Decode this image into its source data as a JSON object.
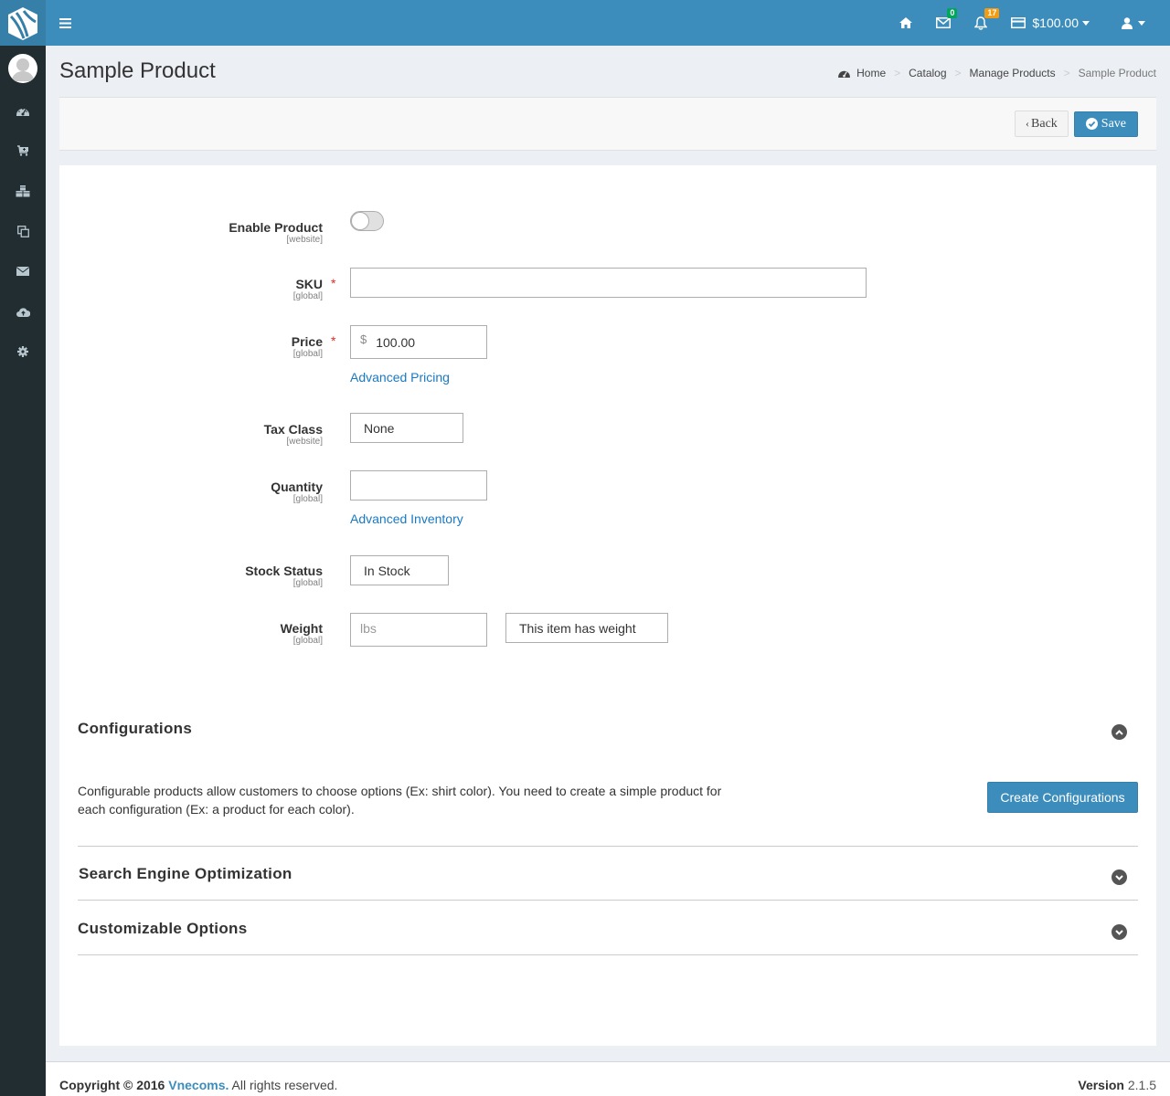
{
  "topbar": {
    "messages_count": "0",
    "notifications_count": "17",
    "balance": "$100.00",
    "colors": {
      "primary": "#3c8dbc",
      "logo_bg": "#367fa9",
      "sidebar_bg": "#222d32"
    }
  },
  "sidebar": {
    "items": [
      {
        "icon": "dashboard-icon"
      },
      {
        "icon": "cart-icon"
      },
      {
        "icon": "cubes-icon"
      },
      {
        "icon": "copy-icon"
      },
      {
        "icon": "envelope-icon"
      },
      {
        "icon": "cloud-upload-icon"
      },
      {
        "icon": "gear-icon"
      }
    ]
  },
  "header": {
    "title": "Sample Product",
    "breadcrumb": [
      "Home",
      "Catalog",
      "Manage Products",
      "Sample Product"
    ],
    "breadcrumb_sep": ">"
  },
  "actions": {
    "back_label": "Back",
    "save_label": "Save"
  },
  "form": {
    "enable_product": {
      "label": "Enable Product",
      "scope": "[website]",
      "enabled": false
    },
    "sku": {
      "label": "SKU",
      "scope": "[global]",
      "required_mark": "*",
      "value": ""
    },
    "price": {
      "label": "Price",
      "scope": "[global]",
      "required_mark": "*",
      "currency": "$",
      "value": "100.00",
      "link": "Advanced Pricing"
    },
    "tax_class": {
      "label": "Tax Class",
      "scope": "[website]",
      "value": "None"
    },
    "quantity": {
      "label": "Quantity",
      "scope": "[global]",
      "value": "",
      "link": "Advanced Inventory"
    },
    "stock_status": {
      "label": "Stock Status",
      "scope": "[global]",
      "value": "In Stock"
    },
    "weight": {
      "label": "Weight",
      "scope": "[global]",
      "placeholder": "lbs",
      "value": "",
      "has_weight": "This item has weight"
    }
  },
  "sections": {
    "configurations": {
      "title": "Configurations",
      "expanded": true,
      "description": "Configurable products allow customers to choose options (Ex: shirt color). You need to create a simple product for each configuration (Ex: a product for each color).",
      "button": "Create Configurations"
    },
    "seo": {
      "title": "Search Engine Optimization",
      "expanded": false
    },
    "custom_options": {
      "title": "Customizable Options",
      "expanded": false
    }
  },
  "footer": {
    "copyright_prefix": "Copyright © 2016",
    "brand": "Vnecoms.",
    "copyright_suffix": "All rights reserved.",
    "version_label": "Version",
    "version": "2.1.5"
  }
}
